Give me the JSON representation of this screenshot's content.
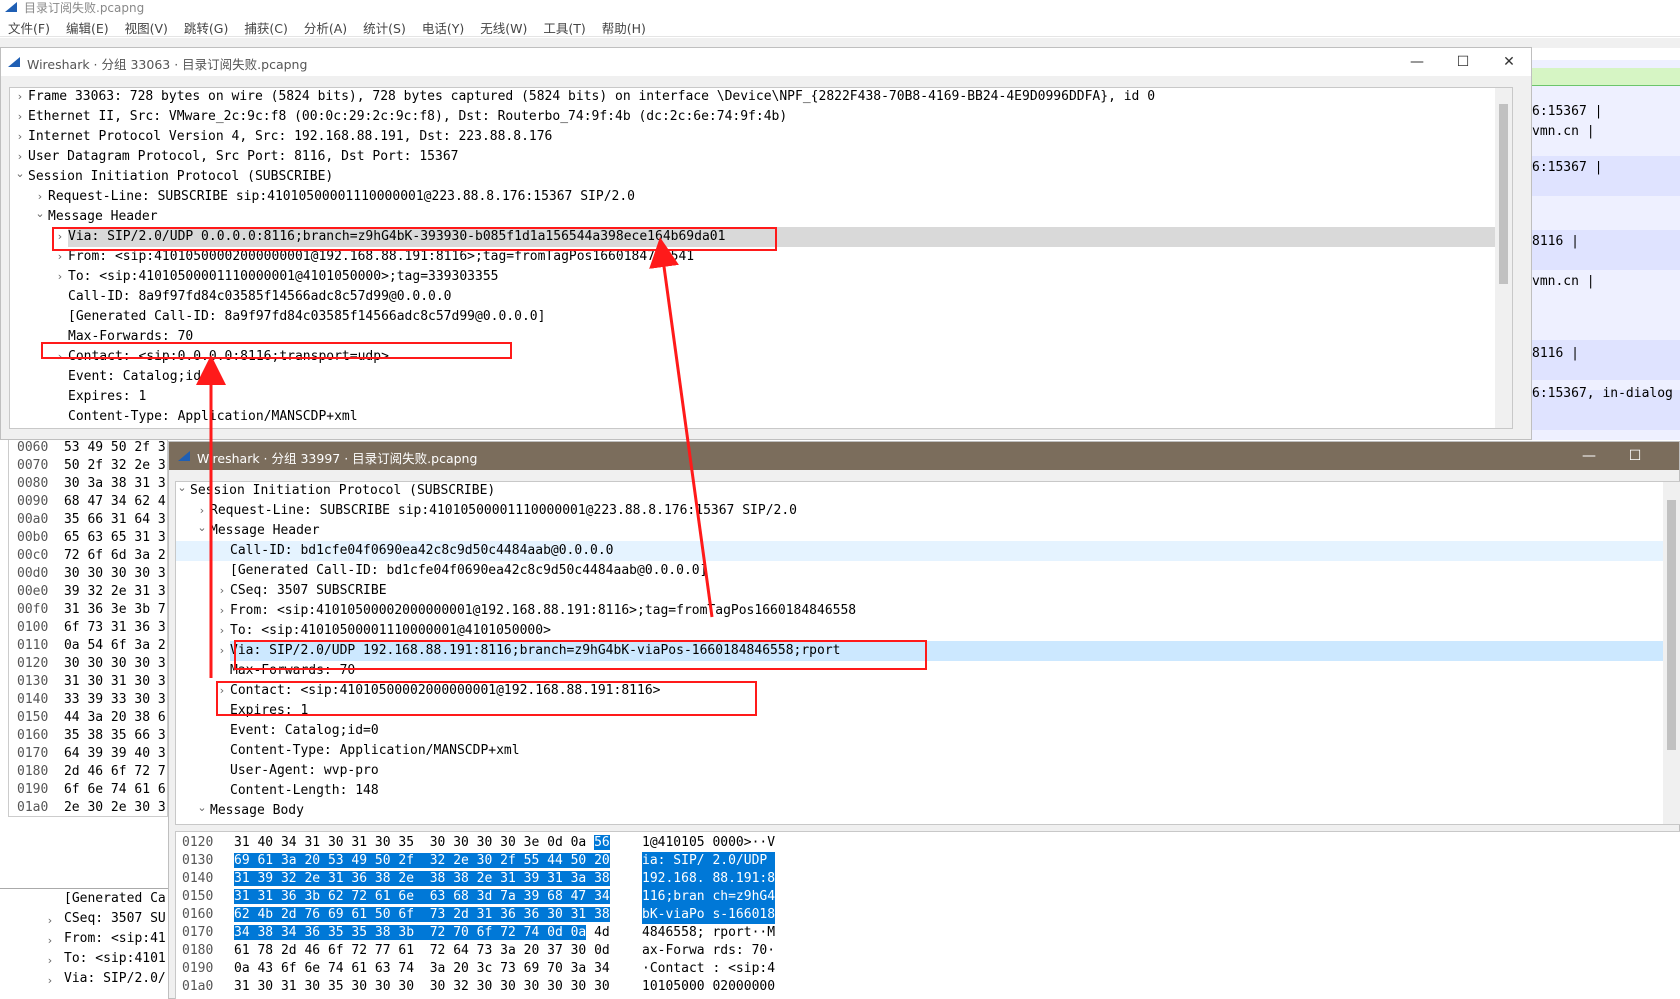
{
  "main_window": {
    "title": "目录订阅失败.pcapng",
    "menu": [
      "文件(F)",
      "编辑(E)",
      "视图(V)",
      "跳转(G)",
      "捕获(C)",
      "分析(A)",
      "统计(S)",
      "电话(Y)",
      "无线(W)",
      "工具(T)",
      "帮助(H)"
    ],
    "right_panel_rows": [
      "6:15367 |",
      "vmn.cn |",
      "6:15367 |",
      "8116 |",
      "vmn.cn |",
      "8116 |",
      "6:15367, in-dialog"
    ],
    "hex_offsets": [
      "0060",
      "0070",
      "0080",
      "0090",
      "00a0",
      "00b0",
      "00c0",
      "00d0",
      "00e0",
      "00f0",
      "0100",
      "0110",
      "0120",
      "0130",
      "0140",
      "0150",
      "0160",
      "0170",
      "0180",
      "0190",
      "01a0"
    ],
    "hex_partial": [
      "53 49 50 2f 3",
      "50 2f 32 2e 3",
      "30 3a 38 31 3",
      "68 47 34 62 4",
      "35 66 31 64 3",
      "65 63 65 31 3",
      "72 6f 6d 3a 2",
      "30 30 30 30 3",
      "39 32 2e 31 3",
      "31 36 3e 3b 7",
      "6f 73 31 36 3",
      "0a 54 6f 3a 2",
      "30 30 30 30 3",
      "31 30 31 30 3",
      "33 39 33 30 3",
      "44 3a 20 38 6",
      "35 38 35 66 3",
      "64 39 39 40 3",
      "2d 46 6f 72 7",
      "6f 6e 74 61 6",
      "2e 30 2e 30 3"
    ],
    "bottom_detail": [
      "[Generated Ca",
      "CSeq: 3507 SU",
      "From: <sip:41",
      "To: <sip:4101",
      "Via: SIP/2.0/"
    ]
  },
  "window1": {
    "title": "Wireshark · 分组 33063 · 目录订阅失败.pcapng",
    "rows": [
      {
        "text": "Frame 33063: 728 bytes on wire (5824 bits), 728 bytes captured (5824 bits) on interface \\Device\\NPF_{2822F438-70B8-4169-BB24-4E9D0996DDFA}, id 0",
        "exp": "›"
      },
      {
        "text": "Ethernet II, Src: VMware_2c:9c:f8 (00:0c:29:2c:9c:f8), Dst: Routerbo_74:9f:4b (dc:2c:6e:74:9f:4b)",
        "exp": "›"
      },
      {
        "text": "Internet Protocol Version 4, Src: 192.168.88.191, Dst: 223.88.8.176",
        "exp": "›"
      },
      {
        "text": "User Datagram Protocol, Src Port: 8116, Dst Port: 15367",
        "exp": "›"
      },
      {
        "text": "Session Initiation Protocol (SUBSCRIBE)",
        "exp": "⌄"
      },
      {
        "text": "Request-Line: SUBSCRIBE sip:41010500001110000001@223.88.8.176:15367 SIP/2.0",
        "exp": "›"
      },
      {
        "text": "Message Header",
        "exp": "⌄"
      },
      {
        "text": "Via: SIP/2.0/UDP 0.0.0.0:8116;branch=z9hG4bK-393930-b085f1d1a156544a398ece164b69da01",
        "exp": "›"
      },
      {
        "text": "From: <sip:41010500002000000001@192.168.88.191:8116>;tag=fromTagPos1660184786541",
        "exp": "›"
      },
      {
        "text": "To: <sip:41010500001110000001@4101050000>;tag=339303355",
        "exp": "›"
      },
      {
        "text": "Call-ID: 8a9f97fd84c03585f14566adc8c57d99@0.0.0.0",
        "exp": ""
      },
      {
        "text": "[Generated Call-ID: 8a9f97fd84c03585f14566adc8c57d99@0.0.0.0]",
        "exp": ""
      },
      {
        "text": "Max-Forwards: 70",
        "exp": ""
      },
      {
        "text": "Contact: <sip:0.0.0.0:8116;transport=udp>",
        "exp": "›"
      },
      {
        "text": "Event: Catalog;id=0",
        "exp": ""
      },
      {
        "text": "Expires: 1",
        "exp": ""
      },
      {
        "text": "Content-Type: Application/MANSCDP+xml",
        "exp": ""
      }
    ]
  },
  "window2": {
    "title": "Wireshark · 分组 33997 · 目录订阅失败.pcapng",
    "rows": [
      {
        "text": "Session Initiation Protocol (SUBSCRIBE)",
        "exp": "⌄"
      },
      {
        "text": "Request-Line: SUBSCRIBE sip:41010500001110000001@223.88.8.176:15367 SIP/2.0",
        "exp": "›"
      },
      {
        "text": "Message Header",
        "exp": "⌄"
      },
      {
        "text": "Call-ID: bd1cfe04f0690ea42c8c9d50c4484aab@0.0.0.0",
        "exp": ""
      },
      {
        "text": "[Generated Call-ID: bd1cfe04f0690ea42c8c9d50c4484aab@0.0.0.0]",
        "exp": ""
      },
      {
        "text": "CSeq: 3507 SUBSCRIBE",
        "exp": "›"
      },
      {
        "text": "From: <sip:41010500002000000001@192.168.88.191:8116>;tag=fromTagPos1660184846558",
        "exp": "›"
      },
      {
        "text": "To: <sip:41010500001110000001@4101050000>",
        "exp": "›"
      },
      {
        "text": "Via: SIP/2.0/UDP 192.168.88.191:8116;branch=z9hG4bK-viaPos-1660184846558;rport",
        "exp": "›"
      },
      {
        "text": "Max-Forwards: 70",
        "exp": ""
      },
      {
        "text": "Contact: <sip:41010500002000000001@192.168.88.191:8116>",
        "exp": "›"
      },
      {
        "text": "Expires: 1",
        "exp": ""
      },
      {
        "text": "Event: Catalog;id=0",
        "exp": ""
      },
      {
        "text": "Content-Type: Application/MANSCDP+xml",
        "exp": ""
      },
      {
        "text": "User-Agent: wvp-pro",
        "exp": ""
      },
      {
        "text": "Content-Length: 148",
        "exp": ""
      },
      {
        "text": "Message Body",
        "exp": "⌄"
      }
    ],
    "hex_rows": [
      {
        "offset": "0120",
        "bytes": [
          "31",
          "40",
          "34",
          "31",
          "30",
          "31",
          "30",
          "35",
          "30",
          "30",
          "30",
          "30",
          "3e",
          "0d",
          "0a",
          "56"
        ],
        "ascii": "1@410105 0000>··V"
      },
      {
        "offset": "0130",
        "bytes": [
          "69",
          "61",
          "3a",
          "20",
          "53",
          "49",
          "50",
          "2f",
          "32",
          "2e",
          "30",
          "2f",
          "55",
          "44",
          "50",
          "20"
        ],
        "ascii": "ia: SIP/ 2.0/UDP "
      },
      {
        "offset": "0140",
        "bytes": [
          "31",
          "39",
          "32",
          "2e",
          "31",
          "36",
          "38",
          "2e",
          "38",
          "38",
          "2e",
          "31",
          "39",
          "31",
          "3a",
          "38"
        ],
        "ascii": "192.168. 88.191:8"
      },
      {
        "offset": "0150",
        "bytes": [
          "31",
          "31",
          "36",
          "3b",
          "62",
          "72",
          "61",
          "6e",
          "63",
          "68",
          "3d",
          "7a",
          "39",
          "68",
          "47",
          "34"
        ],
        "ascii": "116;bran ch=z9hG4"
      },
      {
        "offset": "0160",
        "bytes": [
          "62",
          "4b",
          "2d",
          "76",
          "69",
          "61",
          "50",
          "6f",
          "73",
          "2d",
          "31",
          "36",
          "36",
          "30",
          "31",
          "38"
        ],
        "ascii": "bK-viaPo s-166018"
      },
      {
        "offset": "0170",
        "bytes": [
          "34",
          "38",
          "34",
          "36",
          "35",
          "35",
          "38",
          "3b",
          "72",
          "70",
          "6f",
          "72",
          "74",
          "0d",
          "0a",
          "4d"
        ],
        "ascii": "4846558; rport··M"
      },
      {
        "offset": "0180",
        "bytes": [
          "61",
          "78",
          "2d",
          "46",
          "6f",
          "72",
          "77",
          "61",
          "72",
          "64",
          "73",
          "3a",
          "20",
          "37",
          "30",
          "0d"
        ],
        "ascii": "ax-Forwa rds: 70·"
      },
      {
        "offset": "0190",
        "bytes": [
          "0a",
          "43",
          "6f",
          "6e",
          "74",
          "61",
          "63",
          "74",
          "3a",
          "20",
          "3c",
          "73",
          "69",
          "70",
          "3a",
          "34"
        ],
        "ascii": "·Contact : <sip:4"
      },
      {
        "offset": "01a0",
        "bytes": [
          "31",
          "30",
          "31",
          "30",
          "35",
          "30",
          "30",
          "30",
          "30",
          "32",
          "30",
          "30",
          "30",
          "30",
          "30",
          "30"
        ],
        "ascii": "10105000 02000000"
      }
    ]
  },
  "colors": {
    "annotation": "#ff1a1a",
    "selection_blue": "#0078d7",
    "row_select_light": "#cce8ff",
    "window2_titlebar": "#7b6d5c"
  }
}
